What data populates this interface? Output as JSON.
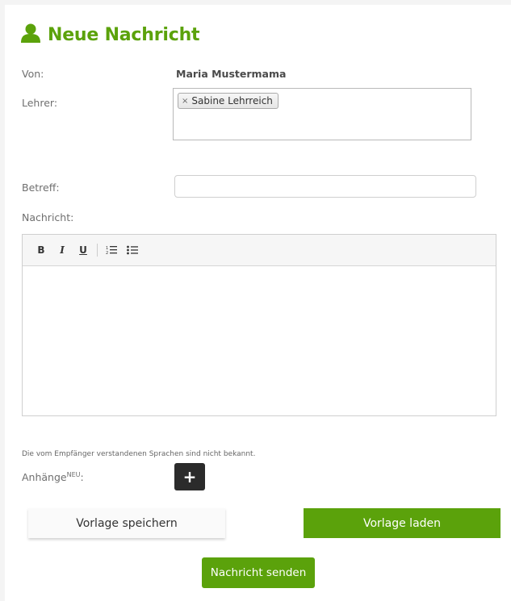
{
  "header": {
    "title": "Neue Nachricht",
    "icon": "user-icon",
    "accent_color": "#5ba20b"
  },
  "form": {
    "from_label": "Von:",
    "from_value": "Maria Mustermama",
    "teacher_label": "Lehrer:",
    "teacher_chips": [
      {
        "label": "Sabine Lehrreich",
        "remove": "×"
      }
    ],
    "subject_label": "Betreff:",
    "subject_value": "",
    "message_label": "Nachricht:",
    "toolbar": {
      "bold": "B",
      "italic": "I",
      "underline": "U",
      "ordered_list": "1≡",
      "bullet_list": "•≡"
    },
    "language_note": "Die vom Empfänger verstandenen Sprachen sind nicht bekannt.",
    "attachments_label": "Anhänge",
    "attachments_badge": "NEU",
    "attachments_colon": ":",
    "add_attachment": "+"
  },
  "actions": {
    "save_template": "Vorlage speichern",
    "load_template": "Vorlage laden",
    "send": "Nachricht senden"
  }
}
